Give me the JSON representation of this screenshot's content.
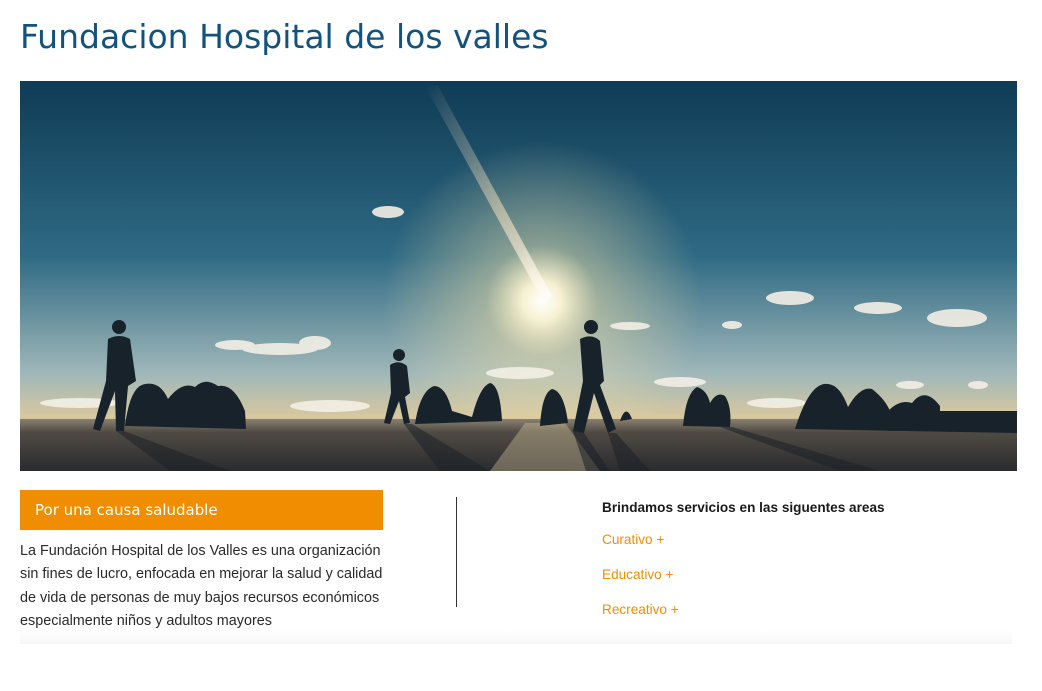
{
  "page": {
    "title": "Fundacion Hospital de los valles"
  },
  "hero": {
    "image_description_icon": "hero-sunset-image"
  },
  "about": {
    "header": "Por una causa saludable",
    "text_lines": [
      "La Fundación Hospital de los Valles es una organización",
      "sin fines de lucro, enfocada en mejorar la salud y calidad",
      "de vida de personas de muy bajos recursos económicos",
      "especialmente niños y adultos mayores"
    ]
  },
  "services": {
    "title": "Brindamos servicios en las siguentes areas",
    "items": [
      "Curativo +",
      "Educativo +",
      "Recreativo +"
    ]
  },
  "colors": {
    "title": "#13527d",
    "accent": "#f18d00"
  }
}
